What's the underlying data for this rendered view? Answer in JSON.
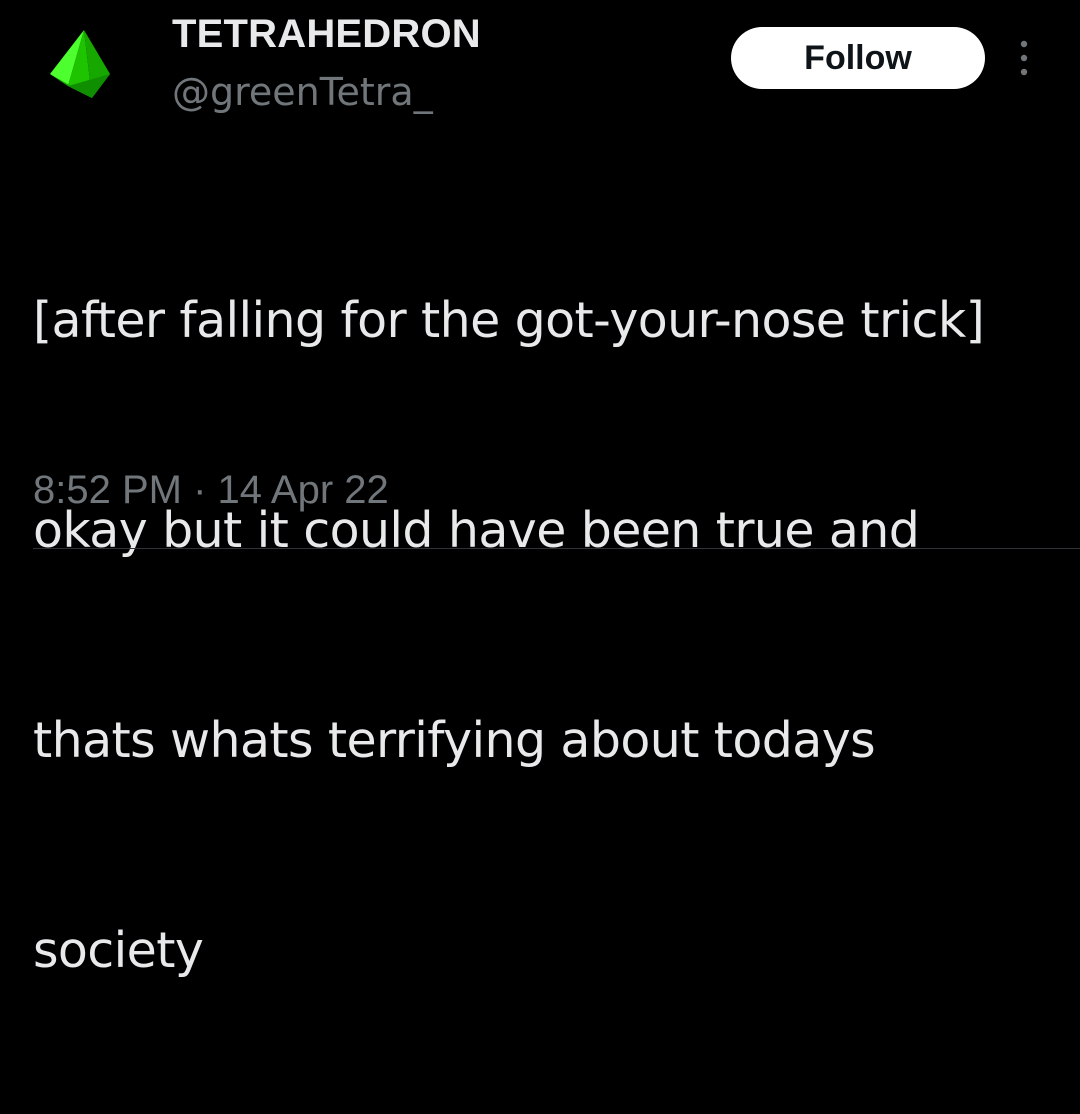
{
  "author": {
    "display_name": "TETRAHEDRON",
    "handle": "@greenTetra_",
    "avatar_icon": "green-tetrahedron-icon",
    "avatar_color": "#22e000"
  },
  "actions": {
    "follow_label": "Follow",
    "more_icon": "vertical-ellipsis-icon"
  },
  "tweet": {
    "lines": [
      "[after falling for the got-your-nose trick]",
      "okay but it could have been true and",
      "thats whats terrifying about todays",
      "society"
    ],
    "timestamp": "8:52 PM · 14 Apr 22"
  },
  "colors": {
    "background": "#000000",
    "primary_text": "#e7e9ea",
    "secondary_text": "#71767b",
    "button_bg": "#ffffff",
    "button_text": "#0f1419"
  }
}
